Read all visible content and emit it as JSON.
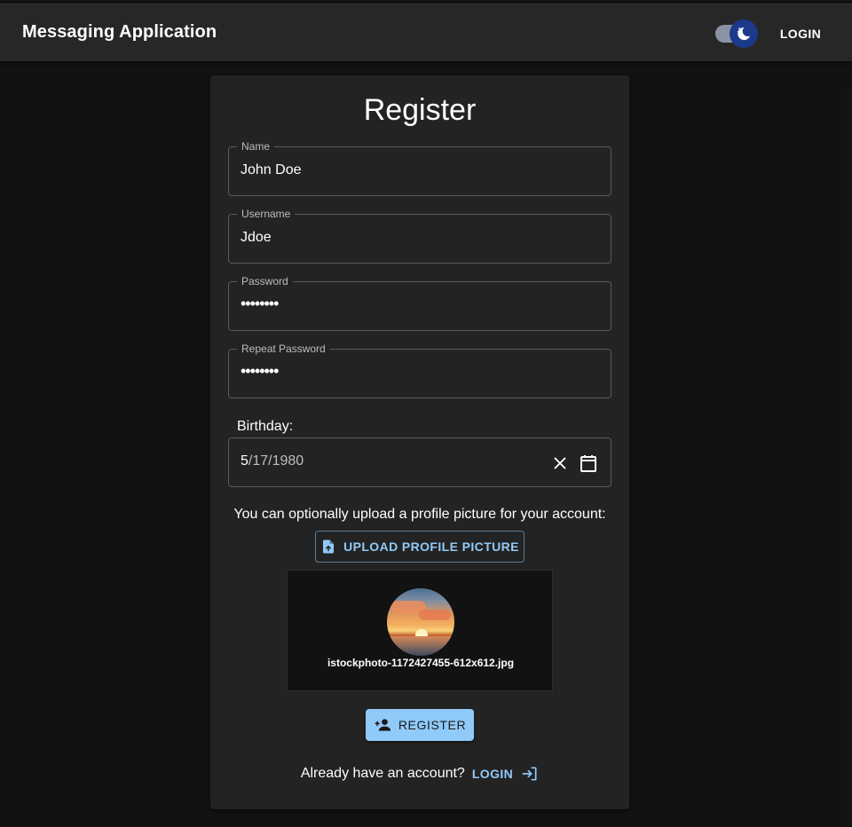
{
  "appbar": {
    "title": "Messaging Application",
    "theme_toggle": {
      "state": "dark",
      "icon": "moon-icon"
    },
    "login_label": "LOGIN"
  },
  "form": {
    "title": "Register",
    "fields": [
      {
        "label": "Name",
        "value": "John Doe",
        "type": "text"
      },
      {
        "label": "Username",
        "value": "Jdoe",
        "type": "text"
      },
      {
        "label": "Password",
        "value": "••••••••",
        "type": "password"
      },
      {
        "label": "Repeat Password",
        "value": "••••••••",
        "type": "password"
      }
    ],
    "birthday": {
      "label": "Birthday:",
      "month": "5",
      "day": "17",
      "year": "1980",
      "separator": "/"
    },
    "upload": {
      "prompt": "You can optionally upload a profile picture for your account:",
      "button_label": "UPLOAD PROFILE PICTURE",
      "filename": "istockphoto-1172427455-612x612.jpg"
    },
    "register_label": "REGISTER",
    "footer": {
      "text": "Already have an account?",
      "login_label": "LOGIN"
    }
  },
  "colors": {
    "background": "#121212",
    "surface": "#232323",
    "appbar": "#272727",
    "accent": "#90caf9",
    "toggle_thumb": "#1c3a8c"
  }
}
